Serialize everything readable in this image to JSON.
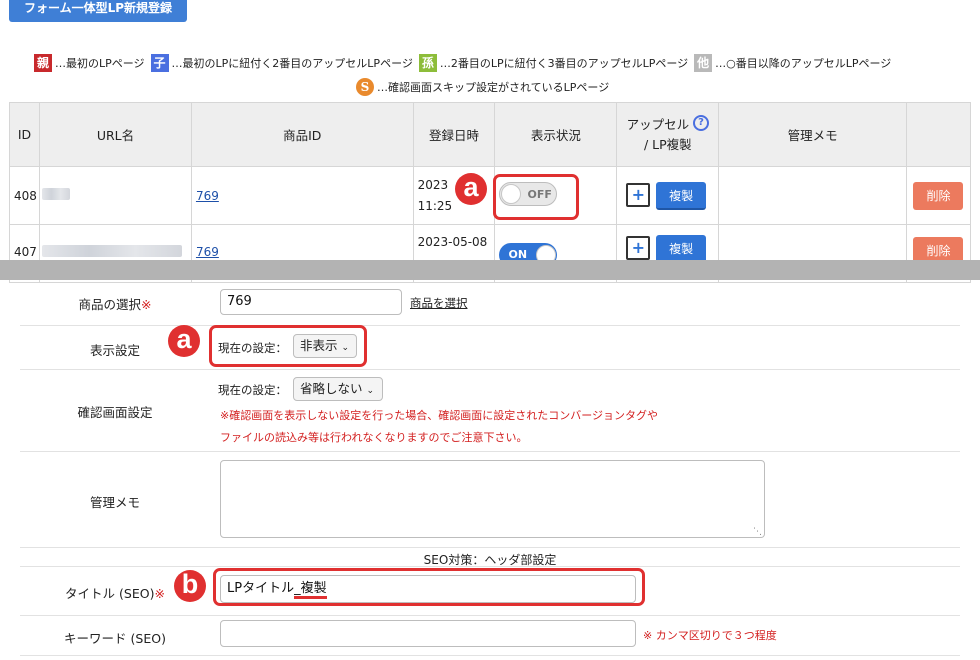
{
  "top": {
    "new_button": "フォーム一体型LP新規登録",
    "legend": [
      {
        "badge": "親",
        "color": "#c8292c",
        "text": "…最初のLPページ"
      },
      {
        "badge": "子",
        "color": "#4a6fe0",
        "text": "…最初のLPに紐付く2番目のアップセルLPページ"
      },
      {
        "badge": "孫",
        "color": "#8dbd3a",
        "text": "…2番目のLPに紐付く3番目のアップセルLPページ"
      },
      {
        "badge": "他",
        "color": "#b9b9b9",
        "text": "…○番目以降のアップセルLPページ"
      }
    ],
    "legend2": {
      "badge": "S",
      "color": "#e98a2d",
      "text": "…確認画面スキップ設定がされているLPページ"
    },
    "table": {
      "headers": [
        "ID",
        "URL名",
        "商品ID",
        "登録日時",
        "表示状況",
        "アップセル",
        "/ LP複製",
        "管理メモ"
      ],
      "help_glyph": "?",
      "rows": [
        {
          "id": "408",
          "product_id": "769",
          "date": "2023",
          "time": "11:25",
          "toggle": "OFF",
          "plus": "+",
          "dup": "複製",
          "del": "削除"
        },
        {
          "id": "407",
          "product_id": "769",
          "date": "2023-05-08",
          "time": "",
          "toggle": "ON",
          "plus": "+",
          "dup": "複製",
          "del": "削除"
        }
      ]
    },
    "annotation_a": "a"
  },
  "form": {
    "product": {
      "label": "商品の選択",
      "req": "※",
      "value": "769",
      "link": "商品を選択"
    },
    "display": {
      "label": "表示設定",
      "current": "現在の設定：",
      "selected": "非表示",
      "annotation": "a"
    },
    "confirm": {
      "label": "確認画面設定",
      "current": "現在の設定：",
      "selected": "省略しない",
      "warn1": "※確認画面を表示しない設定を行った場合、確認画面に設定されたコンバージョンタグや",
      "warn2": "ファイルの読込み等は行われなくなりますのでご注意下さい。"
    },
    "memo": {
      "label": "管理メモ"
    },
    "seo_heading": "SEO対策：ヘッダ部設定",
    "title": {
      "label": "タイトル (SEO)",
      "req": "※",
      "value_plain": "LPタイトル",
      "value_underlined": "_複製",
      "annotation": "b"
    },
    "keyword": {
      "label": "キーワード (SEO)",
      "note": "※ カンマ区切りで３つ程度"
    }
  },
  "colors": {
    "primary": "#2f74d6",
    "danger": "#ec7a5e",
    "annotation": "#e03030",
    "required": "#d32020"
  }
}
